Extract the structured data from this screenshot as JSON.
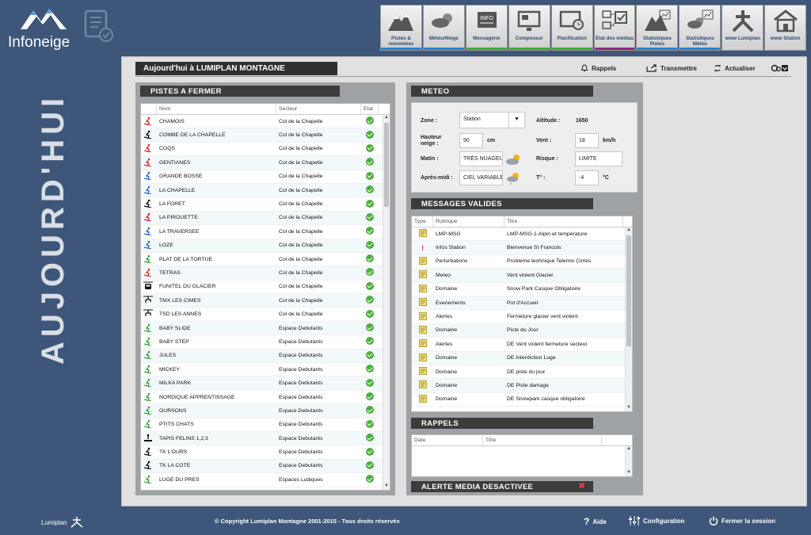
{
  "app": {
    "name": "Infoneige",
    "vertical_title": "AUJOURD'HUI",
    "brand": "Lumiplan",
    "colors": {
      "background": "#3d5679",
      "accent": "#2b4a74",
      "check": "#4caf3c"
    }
  },
  "nav": [
    {
      "label": "Pistes & remontées",
      "icon": "mountain-icon",
      "bar": "#2a7fd1"
    },
    {
      "label": "Météo/Neige",
      "icon": "weather-icon",
      "bar": "#2a7fd1"
    },
    {
      "label": "Messagerie",
      "icon": "info-message-icon",
      "bar": "#3ba83b"
    },
    {
      "label": "Composeur",
      "icon": "composer-screen-icon",
      "bar": "#3ba83b"
    },
    {
      "label": "Planification",
      "icon": "calendar-screen-icon",
      "bar": "#3ba83b"
    },
    {
      "label": "Etat des médias",
      "icon": "media-status-icon",
      "bar": "#8a2c7b"
    },
    {
      "label": "Statistiques Pistes",
      "icon": "stats-mountain-icon",
      "bar": "#2a7fd1"
    },
    {
      "label": "Statistiques Météo",
      "icon": "stats-weather-icon",
      "bar": "#2a7fd1"
    },
    {
      "label": "www Lumiplan",
      "icon": "lumiplan-logo-icon",
      "bar": ""
    },
    {
      "label": "www Station",
      "icon": "house-icon",
      "bar": ""
    }
  ],
  "header": {
    "title": "Aujourd'hui à LUMIPLAN MONTAGNE",
    "rappels": "Rappels",
    "transmettre": "Transmettre",
    "actualiser": "Actualiser"
  },
  "pistes": {
    "title": "PISTES A FERMER",
    "columns": [
      "Nom",
      "Secteur",
      "Etat"
    ],
    "rows": [
      {
        "icon": "red",
        "name": "CHAMOIS",
        "sector": "Col de la Chapelle"
      },
      {
        "icon": "black",
        "name": "COMBE DE LA CHAPELLE",
        "sector": "Col de la Chapelle"
      },
      {
        "icon": "red",
        "name": "COQS",
        "sector": "Col de la Chapelle"
      },
      {
        "icon": "red",
        "name": "GENTIANES",
        "sector": "Col de la Chapelle"
      },
      {
        "icon": "blue",
        "name": "GRANDE BOSSE",
        "sector": "Col de la Chapelle"
      },
      {
        "icon": "blue",
        "name": "LA CHAPELLE",
        "sector": "Col de la Chapelle"
      },
      {
        "icon": "black",
        "name": "LA FORET",
        "sector": "Col de la Chapelle"
      },
      {
        "icon": "red",
        "name": "LA PIROUETTE",
        "sector": "Col de la Chapelle"
      },
      {
        "icon": "blue",
        "name": "LA TRAVERSEE",
        "sector": "Col de la Chapelle"
      },
      {
        "icon": "blue",
        "name": "LOZE",
        "sector": "Col de la Chapelle"
      },
      {
        "icon": "green",
        "name": "PLAT DE LA TORTUE",
        "sector": "Col de la Chapelle"
      },
      {
        "icon": "red",
        "name": "TETRAS",
        "sector": "Col de la Chapelle"
      },
      {
        "icon": "funitel",
        "name": "FUNITEL DU GLACIER",
        "sector": "Col de la Chapelle"
      },
      {
        "icon": "chair",
        "name": "TMX LES CIMES",
        "sector": "Col de la Chapelle"
      },
      {
        "icon": "chair",
        "name": "TSD LES ANNES",
        "sector": "Col de la Chapelle"
      },
      {
        "icon": "green",
        "name": "BABY SLIDE",
        "sector": "Espace Debutants"
      },
      {
        "icon": "green",
        "name": "BABY STEP",
        "sector": "Espace Debutants"
      },
      {
        "icon": "green",
        "name": "JULES",
        "sector": "Espace Debutants"
      },
      {
        "icon": "green",
        "name": "MICKEY",
        "sector": "Espace Debutants"
      },
      {
        "icon": "green",
        "name": "MILKA PARK",
        "sector": "Espace Debutants"
      },
      {
        "icon": "green",
        "name": "NORDIQUE APPRENTISSAGE",
        "sector": "Espace Debutants"
      },
      {
        "icon": "green",
        "name": "OURSONS",
        "sector": "Espace Debutants"
      },
      {
        "icon": "green",
        "name": "PTITS CHATS",
        "sector": "Espace Debutants"
      },
      {
        "icon": "tapis",
        "name": "TAPIS FELINS 1,2,3",
        "sector": "Espace Debutants"
      },
      {
        "icon": "black",
        "name": "TK L'OURS",
        "sector": "Espace Debutants"
      },
      {
        "icon": "black",
        "name": "TK LA COTE",
        "sector": "Espace Debutants"
      },
      {
        "icon": "green",
        "name": "LUGE DU PRES",
        "sector": "Espaces Ludiques"
      }
    ]
  },
  "meteo": {
    "title": "METEO",
    "zone_label": "Zone :",
    "zone_value": "Station",
    "altitude_label": "Altitude :",
    "altitude_value": "1650",
    "hauteur_label": "Hauteur neige :",
    "hauteur_value": "90",
    "hauteur_unit": "cm",
    "vent_label": "Vent :",
    "vent_value": "18",
    "vent_unit": "km/h",
    "matin_label": "Matin :",
    "matin_value": "TRÈS NUAGEUX",
    "risque_label": "Risque :",
    "risque_value": "LIMITE",
    "apresmidi_label": "Après-midi :",
    "apresmidi_value": "CIEL VARIABLE",
    "temp_label": "T° :",
    "temp_value": "-4",
    "temp_unit": "°C"
  },
  "messages": {
    "title": "MESSAGES VALIDES",
    "columns": [
      "Type",
      "Rubrique",
      "Titre"
    ],
    "rows": [
      {
        "type": "note",
        "rubrique": "LMP-MSG",
        "titre": "LMP-MSG-1-Alpin et température"
      },
      {
        "type": "alert",
        "rubrique": "Infos Station",
        "titre": "Bienvenue St Francois"
      },
      {
        "type": "note",
        "rubrique": "Perturbations",
        "titre": "Probleme technique Telemix Cimes"
      },
      {
        "type": "note",
        "rubrique": "Meteo",
        "titre": "Vent violent Glacier"
      },
      {
        "type": "note",
        "rubrique": "Domaine",
        "titre": "Snow Park Casque Obligatoire"
      },
      {
        "type": "note",
        "rubrique": "Evenements",
        "titre": "Pot d'Accueil"
      },
      {
        "type": "note",
        "rubrique": "Alertes",
        "titre": "Fermeture glacier vent violent"
      },
      {
        "type": "note",
        "rubrique": "Domaine",
        "titre": "Piste du Jour"
      },
      {
        "type": "note",
        "rubrique": "Alertes",
        "titre": "DE Vent violent fermeture secteur"
      },
      {
        "type": "note",
        "rubrique": "Domaine",
        "titre": "DE Interdiction Luge"
      },
      {
        "type": "note",
        "rubrique": "Domaine",
        "titre": "DE piste du jour"
      },
      {
        "type": "note",
        "rubrique": "Domaine",
        "titre": "DE Piste damage"
      },
      {
        "type": "note",
        "rubrique": "Domaine",
        "titre": "DE Snowpark casque obligatoire"
      }
    ]
  },
  "rappels": {
    "title": "RAPPELS",
    "columns": [
      "Date",
      "Titre"
    ]
  },
  "alerte": {
    "title": "ALERTE MEDIA DESACTIVEE"
  },
  "footer": {
    "copyright": "© Copyright Lumiplan Montagne 2001-2015 - Tous droits réservés",
    "aide": "Aide",
    "configuration": "Configuration",
    "logout": "Fermer la session"
  }
}
